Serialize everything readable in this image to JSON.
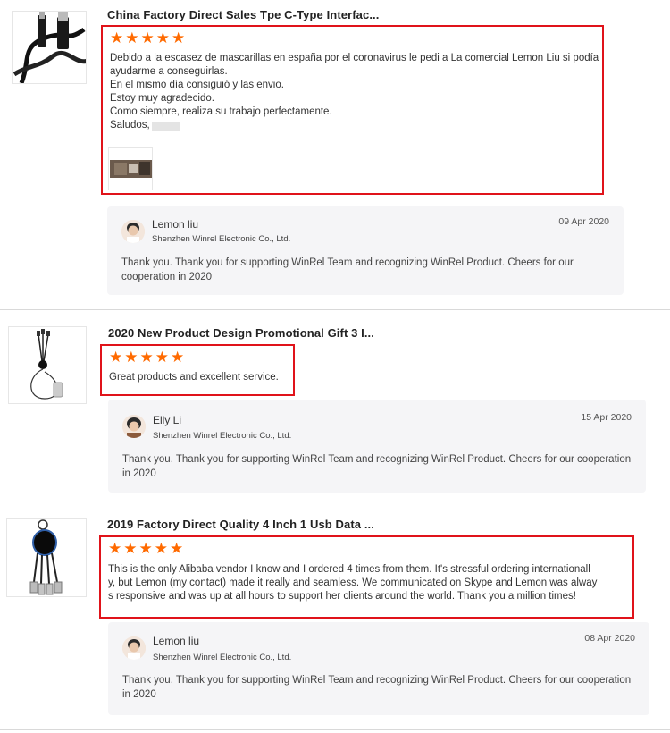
{
  "reviews": [
    {
      "product_title": "China Factory Direct Sales Tpe C-Type Interfac...",
      "rating": 5,
      "text_lines": [
        "Debido a la escasez de mascarillas en españa por el coronavirus le pedi a La comercial Lemon Liu si podía",
        "ayudarme a conseguirlas.",
        "En el mismo día consiguió y las envio.",
        "Estoy muy agradecido.",
        "Como siempre, realiza su trabajo perfectamente.",
        "Saludos,"
      ],
      "reply": {
        "name": "Lemon liu",
        "company": "Shenzhen Winrel Electronic Co., Ltd.",
        "date": "09 Apr 2020",
        "message": "Thank you. Thank you for supporting WinRel Team and recognizing WinRel Product. Cheers for our cooperation in 2020"
      }
    },
    {
      "product_title": "2020 New Product Design Promotional Gift 3 I...",
      "rating": 5,
      "text_lines": [
        "Great products and excellent service."
      ],
      "reply": {
        "name": "Elly Li",
        "company": "Shenzhen Winrel Electronic Co., Ltd.",
        "date": "15 Apr 2020",
        "message": "Thank you. Thank you for supporting WinRel Team and recognizing WinRel Product. Cheers for our cooperation in 2020"
      }
    },
    {
      "product_title": "2019 Factory Direct Quality 4 Inch 1 Usb Data ...",
      "rating": 5,
      "text_lines": [
        "This is the only Alibaba vendor I know and I ordered 4 times from them. It's stressful ordering internationall",
        "y, but Lemon (my contact) made it really and seamless. We communicated on Skype and Lemon was alway",
        "s responsive and was up at all hours to support her clients around the world. Thank you a million times!"
      ],
      "reply": {
        "name": "Lemon liu",
        "company": "Shenzhen Winrel Electronic Co., Ltd.",
        "date": "08 Apr 2020",
        "message": "Thank you. Thank you for supporting WinRel Team and recognizing WinRel Product. Cheers for our cooperation in 2020"
      }
    }
  ],
  "colors": {
    "star": "#ff6a00",
    "highlight_border": "#e0131a",
    "reply_bg": "#f5f5f7"
  },
  "icons": {
    "star": "star-icon"
  }
}
